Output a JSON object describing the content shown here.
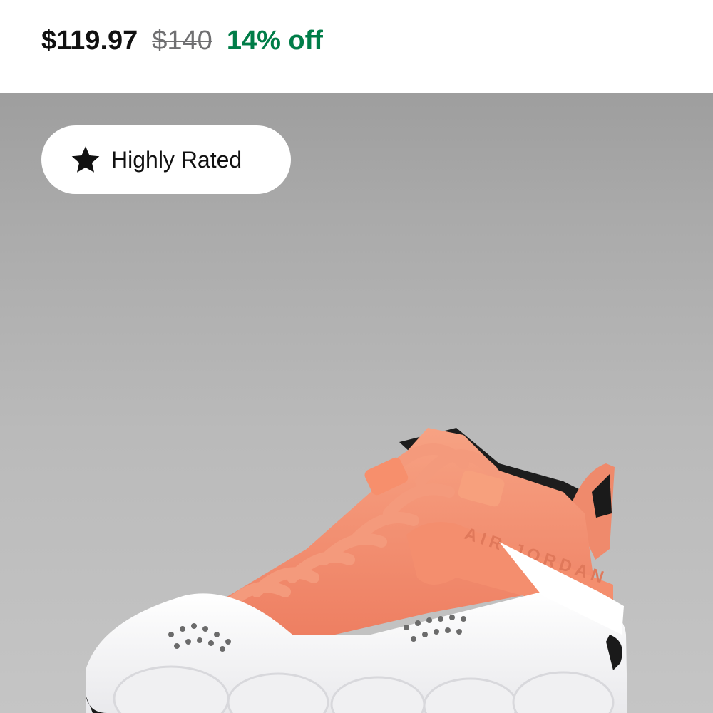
{
  "price": {
    "current": "$119.97",
    "original": "$140",
    "discount": "14% off",
    "discount_color": "#007d48"
  },
  "badge": {
    "label": "Highly Rated",
    "icon": "star-icon"
  },
  "product_image": {
    "text": "AIR JORDAN",
    "colors": {
      "primary": "#f08868",
      "secondary": "#ffffff",
      "accent": "#1a1a1a"
    }
  }
}
